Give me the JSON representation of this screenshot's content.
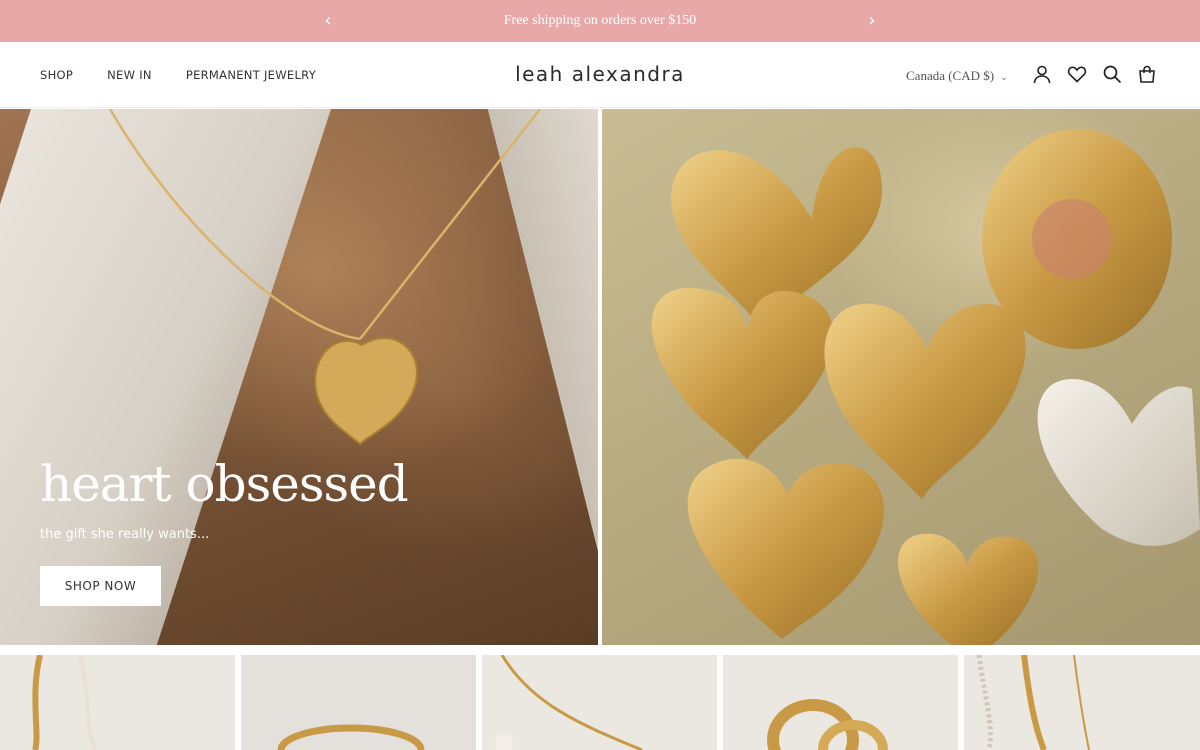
{
  "announcement": {
    "message": "Free shipping on orders over $150",
    "prev_icon": "chevron-left-icon",
    "next_icon": "chevron-right-icon",
    "bg_color": "#e8a8a8"
  },
  "header": {
    "nav": [
      "SHOP",
      "NEW IN",
      "PERMANENT JEWELRY"
    ],
    "logo": "leah alexandra",
    "currency": "Canada (CAD $)",
    "icons": [
      "account-icon",
      "wishlist-heart-icon",
      "search-icon",
      "cart-bag-icon"
    ]
  },
  "hero": {
    "title": "heart obsessed",
    "subtitle": "the gift she really wants...",
    "cta": "SHOP NOW"
  },
  "product_tiles": [
    "tile-1",
    "tile-2",
    "tile-3",
    "tile-4",
    "tile-5"
  ]
}
